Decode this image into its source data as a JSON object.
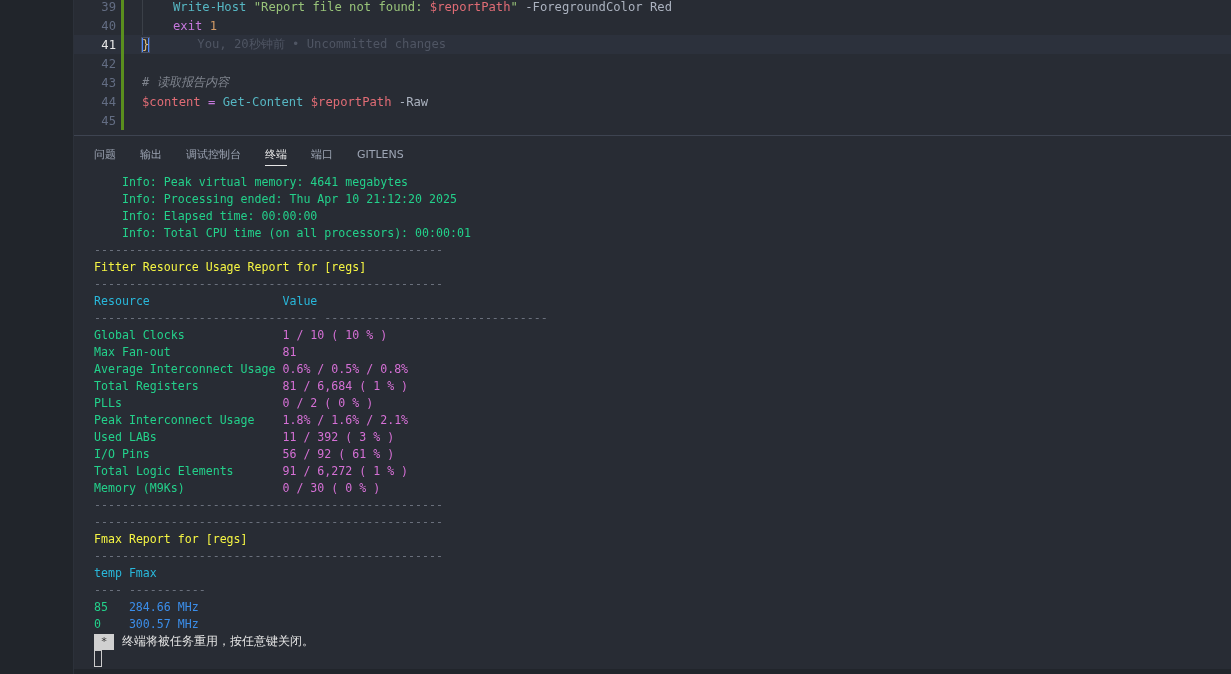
{
  "editor": {
    "lines": [
      {
        "number": "39",
        "active": false,
        "indent": true,
        "tokens": [
          {
            "kind": "command",
            "text": "Write-Host "
          },
          {
            "kind": "string",
            "text": "\"Report file not found: "
          },
          {
            "kind": "variable",
            "text": "$reportPath"
          },
          {
            "kind": "string",
            "text": "\" "
          },
          {
            "kind": "plain",
            "text": "-ForegroundColor Red"
          }
        ]
      },
      {
        "number": "40",
        "active": false,
        "indent": true,
        "tokens": [
          {
            "kind": "keyword",
            "text": "exit "
          },
          {
            "kind": "number",
            "text": "1"
          }
        ]
      },
      {
        "number": "41",
        "active": true,
        "tokens": [
          {
            "kind": "brace",
            "text": "}"
          }
        ],
        "blame": "You, 20秒钟前 • Uncommitted changes"
      },
      {
        "number": "42",
        "active": false
      },
      {
        "number": "43",
        "active": false,
        "tokens": [
          {
            "kind": "comment",
            "text": "# 读取报告内容"
          }
        ]
      },
      {
        "number": "44",
        "active": false,
        "tokens": [
          {
            "kind": "variable",
            "text": "$content"
          },
          {
            "kind": "operator",
            "text": " = "
          },
          {
            "kind": "command",
            "text": "Get-Content "
          },
          {
            "kind": "variable",
            "text": "$reportPath "
          },
          {
            "kind": "plain",
            "text": "-Raw"
          }
        ]
      },
      {
        "number": "45",
        "active": false
      }
    ]
  },
  "panel": {
    "tabs": [
      {
        "label": "问题",
        "selected": false
      },
      {
        "label": "输出",
        "selected": false
      },
      {
        "label": "调试控制台",
        "selected": false
      },
      {
        "label": "终端",
        "selected": true
      },
      {
        "label": "端口",
        "selected": false
      },
      {
        "label": "GITLENS",
        "selected": false
      }
    ],
    "terminal": {
      "blocks": [
        {
          "kind": "info",
          "lines": [
            "Info: Peak virtual memory: 4641 megabytes",
            "Info: Processing ended: Thu Apr 10 21:12:20 2025",
            "Info: Elapsed time: 00:00:00",
            "Info: Total CPU time (on all processors): 00:00:01"
          ]
        },
        {
          "kind": "rule",
          "text": "--------------------------------------------------"
        },
        {
          "kind": "heading",
          "text": "Fitter Resource Usage Report for [regs]"
        },
        {
          "kind": "rule",
          "text": "--------------------------------------------------"
        },
        {
          "kind": "table",
          "color": "#d670d6",
          "header": [
            "Resource",
            "Value"
          ],
          "rule": [
            "--------------------------------",
            "--------------------------------"
          ],
          "rows": [
            [
              "Global Clocks",
              "1 / 10 ( 10 % )"
            ],
            [
              "Max Fan-out",
              "81"
            ],
            [
              "Average Interconnect Usage",
              "0.6% / 0.5% / 0.8%"
            ],
            [
              "Total Registers",
              "81 / 6,684 ( 1 % )"
            ],
            [
              "PLLs",
              "0 / 2 ( 0 % )"
            ],
            [
              "Peak Interconnect Usage",
              "1.8% / 1.6% / 2.1%"
            ],
            [
              "Used LABs",
              "11 / 392 ( 3 % )"
            ],
            [
              "I/O Pins",
              "56 / 92 ( 61 % )"
            ],
            [
              "Total Logic Elements",
              "91 / 6,272 ( 1 % )"
            ],
            [
              "Memory (M9Ks)",
              "0 / 30 ( 0 % )"
            ]
          ]
        },
        {
          "kind": "rule",
          "text": "--------------------------------------------------"
        },
        {
          "kind": "rule",
          "text": "--------------------------------------------------"
        },
        {
          "kind": "heading",
          "text": "Fmax Report for [regs]"
        },
        {
          "kind": "rule",
          "text": "--------------------------------------------------"
        },
        {
          "kind": "table",
          "color": "#3b8eea",
          "header": [
            "temp",
            "Fmax"
          ],
          "rule": [
            "----",
            "-----------"
          ],
          "rows": [
            [
              "85",
              "284.66 MHz"
            ],
            [
              "0",
              "300.57 MHz"
            ]
          ]
        }
      ],
      "notice": {
        "badge": "*",
        "text": "终端将被任务重用，按任意键关闭。"
      }
    }
  }
}
